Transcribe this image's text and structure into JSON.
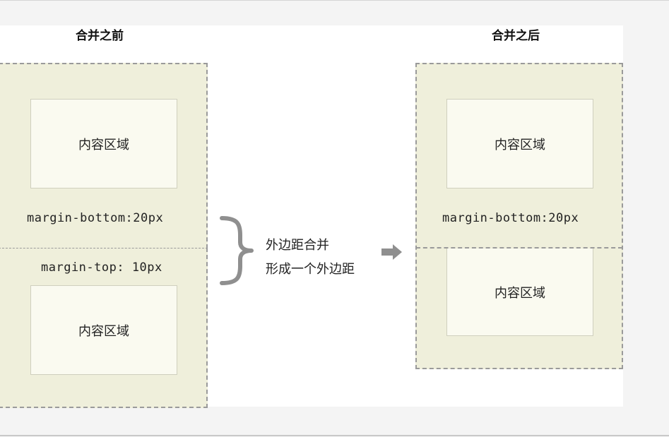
{
  "titles": {
    "before": "合并之前",
    "after": "合并之后"
  },
  "boxes": {
    "content_label": "内容区域"
  },
  "margins": {
    "bottom": "margin-bottom:20px",
    "top": "margin-top: 10px"
  },
  "note": {
    "line1": "外边距合并",
    "line2": "形成一个外边距"
  },
  "colors": {
    "box_fill": "#efefdb",
    "content_fill": "#fafaf0",
    "dash": "#9a9a9a",
    "arrow": "#8f8f8f"
  },
  "icons": {
    "brace": "right-curly-brace-icon",
    "arrow": "right-arrow-icon"
  }
}
